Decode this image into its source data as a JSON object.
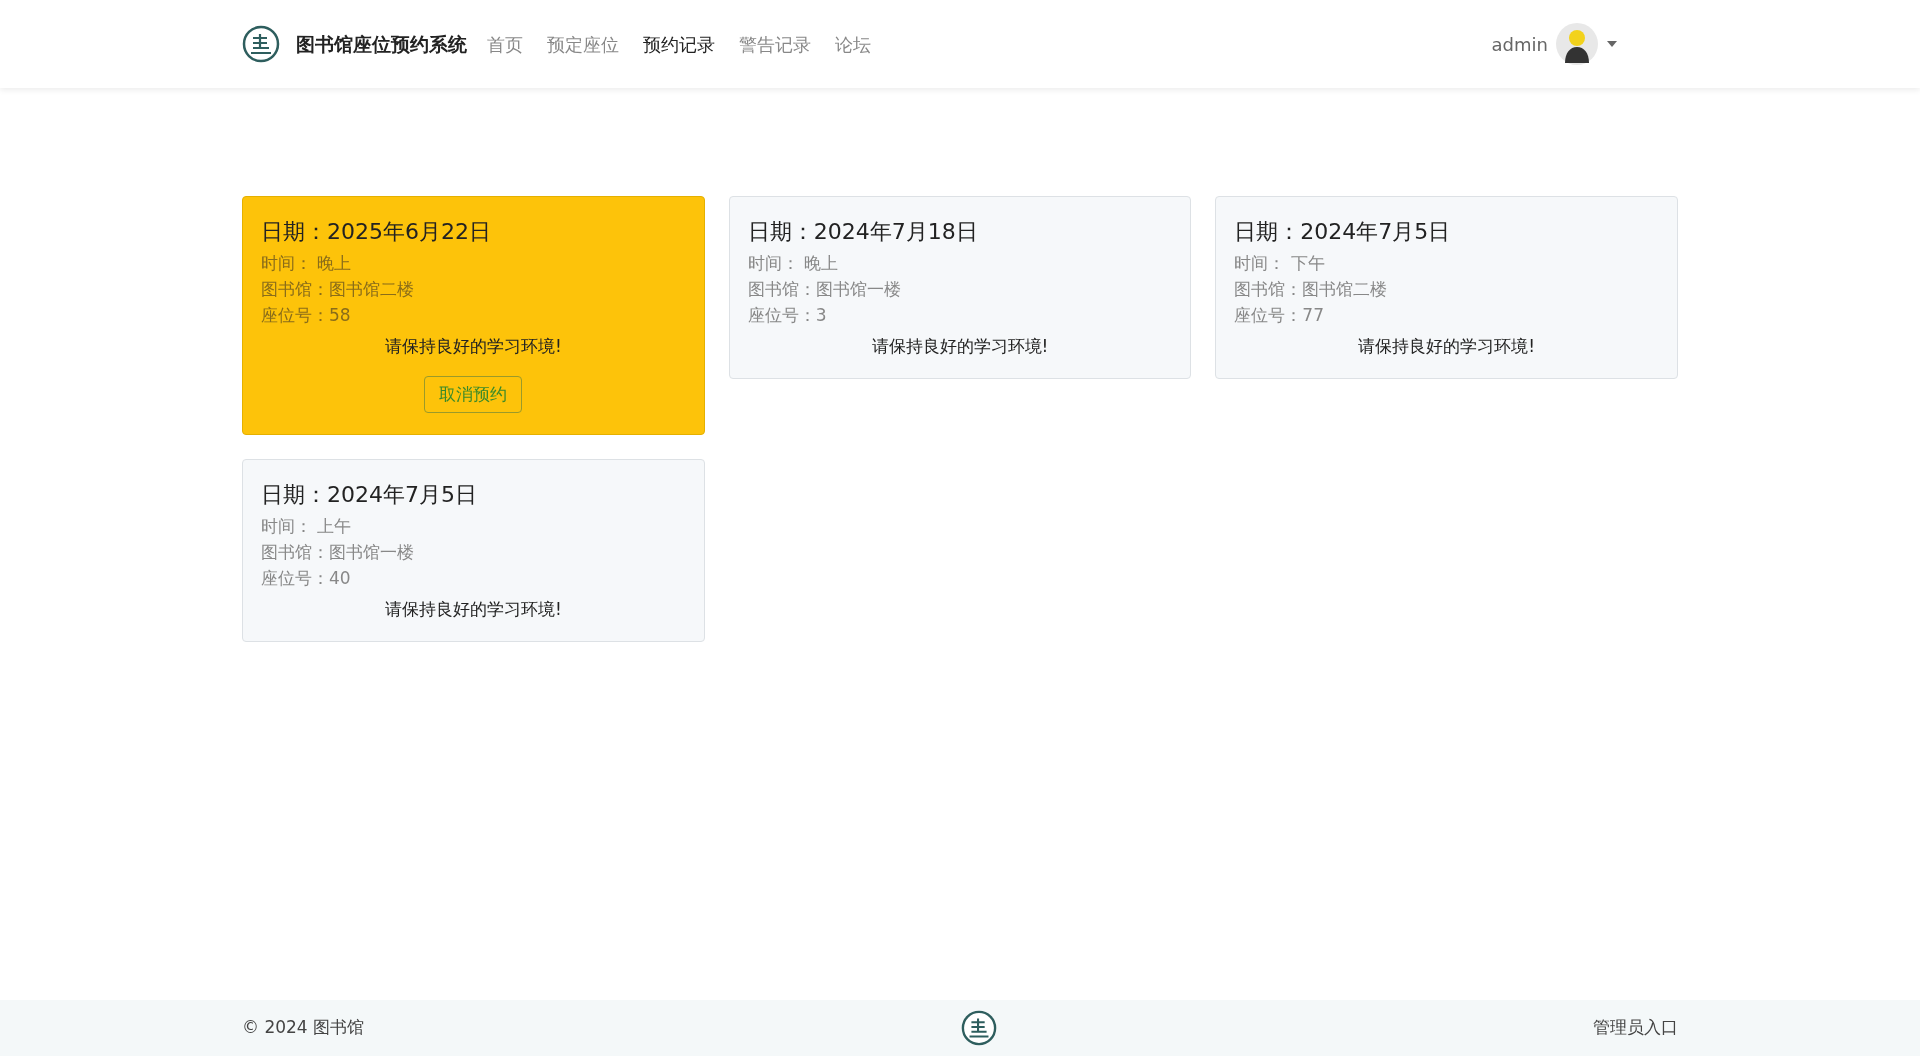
{
  "navbar": {
    "brand": "图书馆座位预约系统",
    "items": [
      {
        "label": "首页",
        "selected": false
      },
      {
        "label": "预定座位",
        "selected": false
      },
      {
        "label": "预约记录",
        "selected": true
      },
      {
        "label": "警告记录",
        "selected": false
      },
      {
        "label": "论坛",
        "selected": false
      }
    ],
    "user": "admin"
  },
  "reservations": [
    {
      "date_label": "日期：",
      "date": "2025年6月22日",
      "time_label": "时间：",
      "time": "晚上",
      "library_label": "图书馆：",
      "library": "图书馆二楼",
      "seat_label": "座位号：",
      "seat": "58",
      "message": "请保持良好的学习环境!",
      "highlighted": true,
      "cancel_button": "取消预约"
    },
    {
      "date_label": "日期：",
      "date": "2024年7月18日",
      "time_label": "时间：",
      "time": "晚上",
      "library_label": "图书馆：",
      "library": "图书馆一楼",
      "seat_label": "座位号：",
      "seat": "3",
      "message": "请保持良好的学习环境!",
      "highlighted": false
    },
    {
      "date_label": "日期：",
      "date": "2024年7月5日",
      "time_label": "时间：",
      "time": "下午",
      "library_label": "图书馆：",
      "library": "图书馆二楼",
      "seat_label": "座位号：",
      "seat": "77",
      "message": "请保持良好的学习环境!",
      "highlighted": false
    },
    {
      "date_label": "日期：",
      "date": "2024年7月5日",
      "time_label": "时间：",
      "time": "上午",
      "library_label": "图书馆：",
      "library": "图书馆一楼",
      "seat_label": "座位号：",
      "seat": "40",
      "message": "请保持良好的学习环境!",
      "highlighted": false
    }
  ],
  "footer": {
    "copyright": "© 2024 图书馆",
    "admin_link": "管理员入口"
  }
}
